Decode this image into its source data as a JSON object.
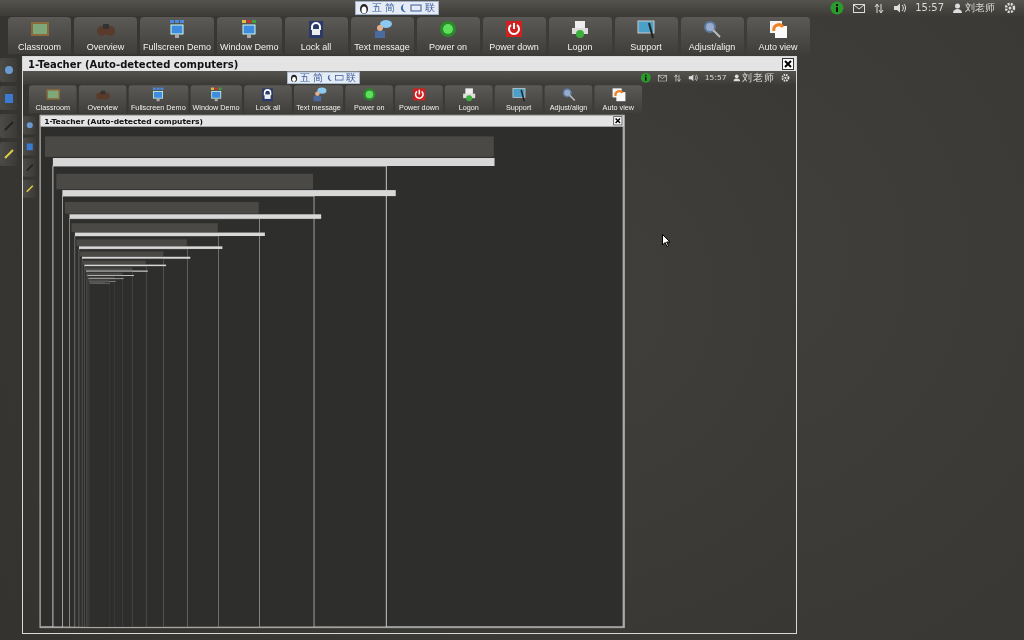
{
  "screen": {
    "input_method": [
      "五",
      "简",
      "联"
    ],
    "tray": {
      "time": "15:57",
      "user": "刘老师"
    },
    "toolbar": [
      "Classroom",
      "Overview",
      "Fullscreen Demo",
      "Window Demo",
      "Lock all",
      "Text message",
      "Power on",
      "Power down",
      "Logon",
      "Support",
      "Adjust/align",
      "Auto view"
    ],
    "window": {
      "title": "1-Teacher (Auto-detected computers)",
      "screen": {
        "input_method": [
          "五",
          "简",
          "联"
        ],
        "tray": {
          "time": "15:57",
          "user": "刘老师"
        },
        "toolbar": [
          "Classroom",
          "Overview",
          "Fullscreen Demo",
          "Window Demo",
          "Lock all",
          "Text message",
          "Power on",
          "Power down",
          "Logon",
          "Support",
          "Adjust/align",
          "Auto view"
        ],
        "window": {
          "title": "1-Teacher (Auto-detected computers)"
        }
      }
    }
  }
}
